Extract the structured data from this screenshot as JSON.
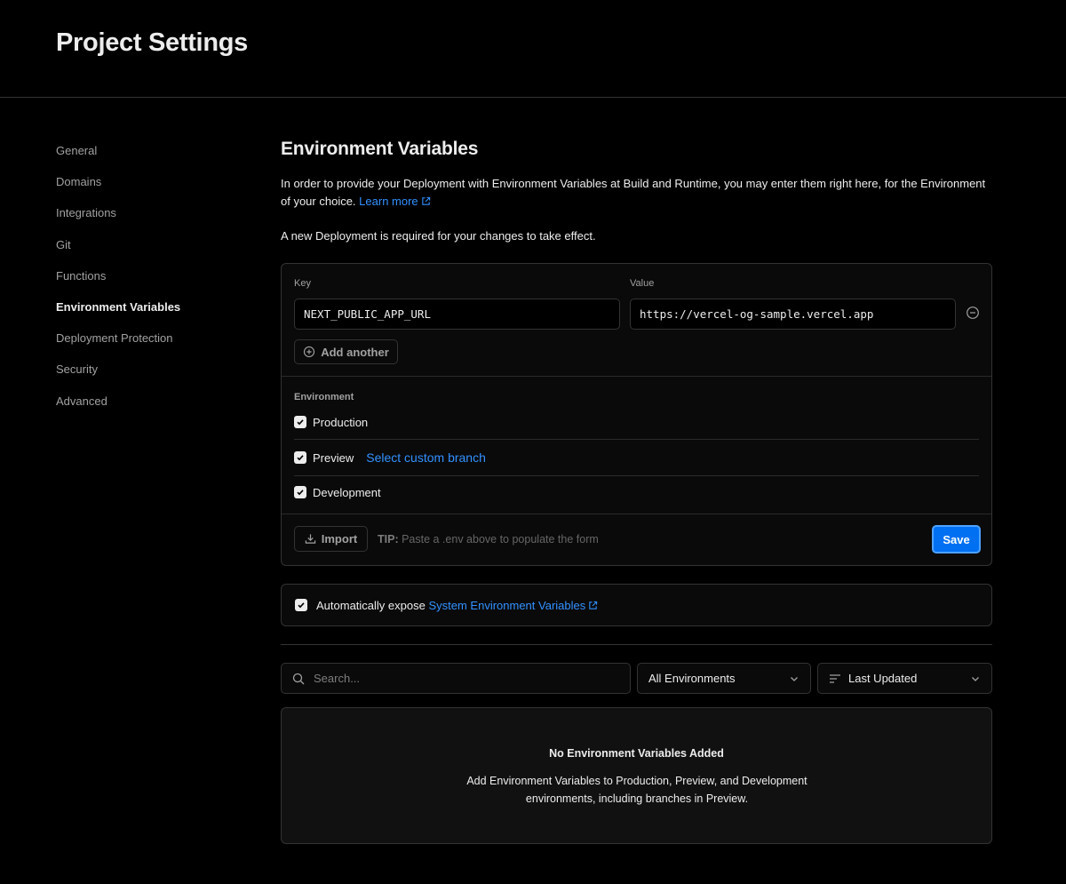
{
  "header": {
    "title": "Project Settings"
  },
  "sidebar": {
    "items": [
      {
        "label": "General"
      },
      {
        "label": "Domains"
      },
      {
        "label": "Integrations"
      },
      {
        "label": "Git"
      },
      {
        "label": "Functions"
      },
      {
        "label": "Environment Variables",
        "active": true
      },
      {
        "label": "Deployment Protection"
      },
      {
        "label": "Security"
      },
      {
        "label": "Advanced"
      }
    ]
  },
  "section": {
    "title": "Environment Variables",
    "description": "In order to provide your Deployment with Environment Variables at Build and Runtime, you may enter them right here, for the Environment of your choice.",
    "learn_more": "Learn more",
    "note": "A new Deployment is required for your changes to take effect."
  },
  "form": {
    "key_label": "Key",
    "value_label": "Value",
    "key_value": "NEXT_PUBLIC_APP_URL",
    "value_value": "https://vercel-og-sample.vercel.app",
    "add_another": "Add another",
    "environment_label": "Environment",
    "environments": [
      {
        "label": "Production",
        "checked": true
      },
      {
        "label": "Preview",
        "checked": true
      },
      {
        "label": "Development",
        "checked": true
      }
    ],
    "custom_branch": "Select custom branch",
    "import_label": "Import",
    "tip_prefix": "TIP:",
    "tip_text": "Paste a .env above to populate the form",
    "save_label": "Save"
  },
  "expose": {
    "checked": true,
    "text": "Automatically expose",
    "link": "System Environment Variables"
  },
  "filters": {
    "search_placeholder": "Search...",
    "environment_select": "All Environments",
    "sort_select": "Last Updated"
  },
  "empty": {
    "title": "No Environment Variables Added",
    "description": "Add Environment Variables to Production, Preview, and Development environments, including branches in Preview."
  },
  "colors": {
    "background": "#000000",
    "accent": "#0070f3",
    "link": "#3291ff",
    "border": "#333333"
  }
}
